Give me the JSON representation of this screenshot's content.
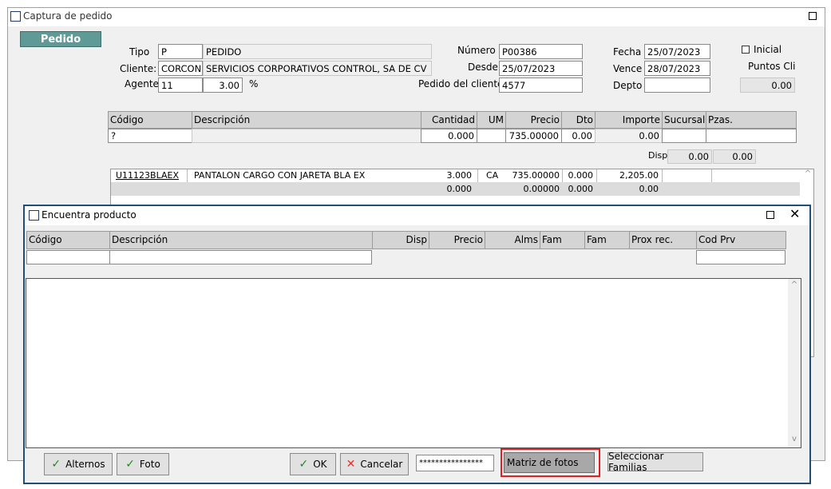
{
  "main_window": {
    "title": "Captura de pedido",
    "tab_label": "Pedido",
    "labels": {
      "tipo": "Tipo",
      "cliente": "Cliente:",
      "agente": "Agente",
      "percent": "%",
      "numero": "Número",
      "desde": "Desde",
      "pedido_cliente": "Pedido del cliente",
      "fecha": "Fecha",
      "vence": "Vence",
      "depto": "Depto",
      "inicial": "Inicial",
      "puntos_cli": "Puntos Cli",
      "disp": "Disp"
    },
    "values": {
      "tipo_code": "P",
      "tipo_desc": "PEDIDO",
      "cliente_code": "CORCON",
      "cliente_name": "SERVICIOS CORPORATIVOS CONTROL, SA DE CV",
      "agente_code": "11",
      "agente_pct": "3.00",
      "numero": "P00386",
      "desde": "25/07/2023",
      "pedido_cliente": "4577",
      "fecha": "25/07/2023",
      "vence": "28/07/2023",
      "depto": "",
      "puntos_cli": "0.00",
      "disp_1": "0.00",
      "disp_2": "0.00"
    },
    "grid_headers": {
      "codigo": "Código",
      "descripcion": "Descripción",
      "cantidad": "Cantidad",
      "um": "UM",
      "precio": "Precio",
      "dto": "Dto",
      "importe": "Importe",
      "sucursal": "Sucursal",
      "pzas": "Pzas."
    },
    "entry_row": {
      "codigo": "?",
      "cantidad": "0.000",
      "precio": "735.00000",
      "dto": "0.00",
      "importe": "0.00"
    },
    "lines": [
      {
        "codigo": "U11123BLAEX",
        "descripcion": "PANTALON CARGO CON JARETA BLA EX",
        "cantidad": "3.000",
        "um": "CA",
        "precio": "735.00000",
        "dto": "0.000",
        "importe": "2,205.00"
      }
    ],
    "totals_row": {
      "cantidad": "0.000",
      "precio": "0.00000",
      "dto": "0.000",
      "importe": "0.00"
    }
  },
  "dialog": {
    "title": "Encuentra producto",
    "headers": {
      "codigo": "Código",
      "descripcion": "Descripción",
      "disp": "Disp",
      "precio": "Precio",
      "alms": "Alms",
      "fam1": "Fam",
      "fam2": "Fam",
      "prox_rec": "Prox rec.",
      "cod_prv": "Cod Prv"
    },
    "buttons": {
      "alternos": "Alternos",
      "foto": "Foto",
      "ok": "OK",
      "cancelar": "Cancelar",
      "password": "****************",
      "matriz": "Matriz de fotos",
      "familias": "Seleccionar Familias"
    }
  },
  "colors": {
    "tab_bg": "#5f9a96",
    "dialog_border": "#1f4e79",
    "highlight_border": "#e02020",
    "header_bg": "#d4d4d4"
  }
}
